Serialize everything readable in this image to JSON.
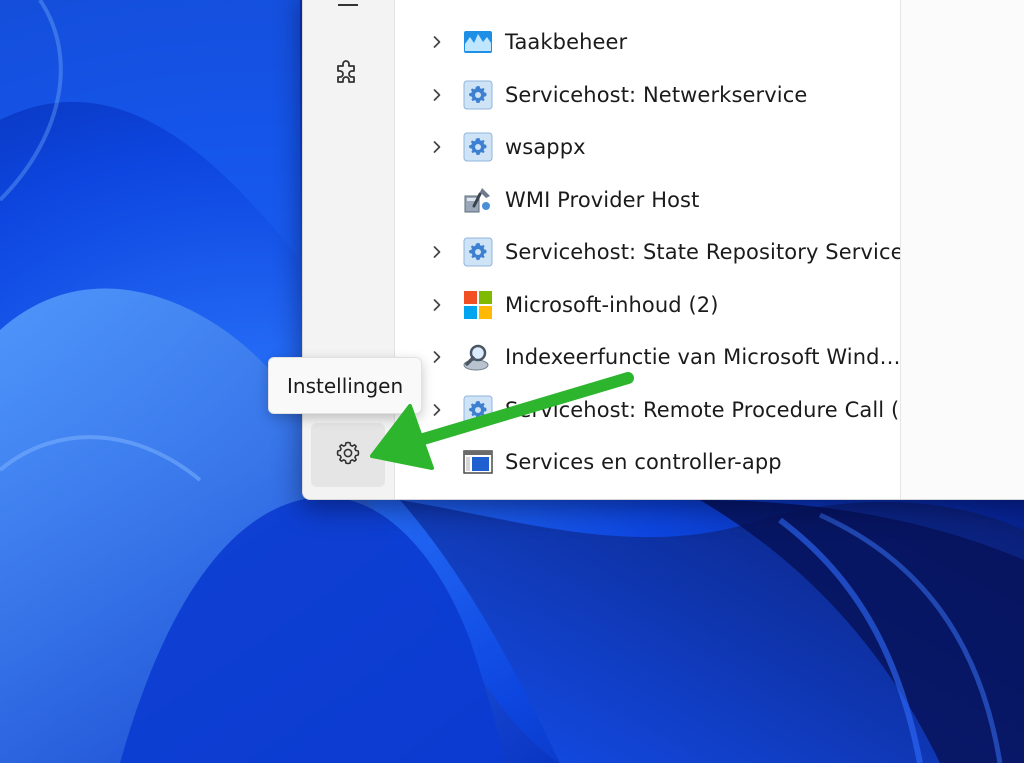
{
  "colors": {
    "accent_arrow": "#2db52d",
    "wallpaper_base": "#0a3fd6",
    "window_bg": "#ffffff",
    "sidebar_bg": "#f3f3f3"
  },
  "sidebar": {
    "items": [
      {
        "icon": "list-icon"
      },
      {
        "icon": "puzzle-icon"
      },
      {
        "icon": "gear-icon"
      }
    ]
  },
  "tooltip": {
    "text": "Instellingen"
  },
  "processes": [
    {
      "label": "Taakbeheer",
      "icon": "task-manager-icon",
      "expandable": true
    },
    {
      "label": "Servicehost: Netwerkservice",
      "icon": "service-gear-icon",
      "expandable": true
    },
    {
      "label": "wsappx",
      "icon": "service-gear-icon",
      "expandable": true
    },
    {
      "label": "WMI Provider Host",
      "icon": "wmi-host-icon",
      "expandable": false
    },
    {
      "label": "Servicehost: State Repository Service",
      "icon": "service-gear-icon",
      "expandable": true
    },
    {
      "label": "Microsoft-inhoud (2)",
      "icon": "microsoft-logo-icon",
      "expandable": true
    },
    {
      "label": "Indexeerfunctie van Microsoft Wind…",
      "icon": "indexer-search-icon",
      "expandable": true
    },
    {
      "label": "Servicehost: Remote Procedure Call (…",
      "icon": "service-gear-icon",
      "expandable": true
    },
    {
      "label": "Services en controller-app",
      "icon": "services-app-icon",
      "expandable": false
    }
  ]
}
